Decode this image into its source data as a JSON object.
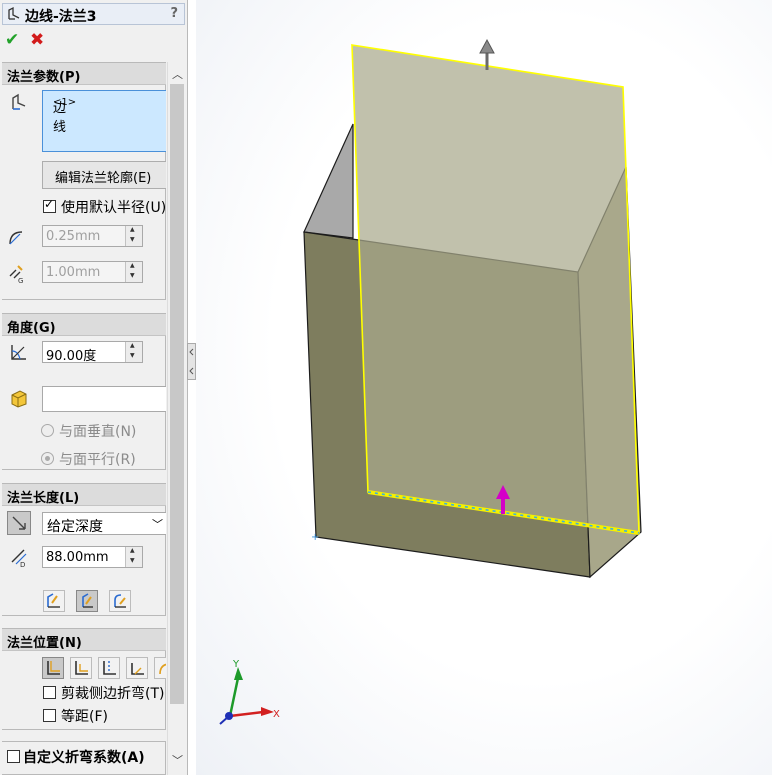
{
  "feature": {
    "title": "边线-法兰3",
    "help": "?",
    "ok_icon": "✔",
    "cancel_icon": "✖"
  },
  "flange_params": {
    "header": "法兰参数(P)",
    "edge_item": "边线",
    "edge_suffix": "<1>",
    "edit_profile_button": "编辑法兰轮廓(E)",
    "use_default_radius": "使用默认半径(U)",
    "use_default_radius_checked": true,
    "radius_value": "0.25mm",
    "gap_value": "1.00mm"
  },
  "angle": {
    "header": "角度(G)",
    "angle_value": "90.00度",
    "face_select_value": "",
    "perpendicular_label": "与面垂直(N)",
    "parallel_label": "与面平行(R)"
  },
  "length": {
    "header": "法兰长度(L)",
    "end_condition": "给定深度",
    "length_value": "88.00mm"
  },
  "position": {
    "header": "法兰位置(N)",
    "trim_side_bends": "剪裁侧边折弯(T)",
    "offset": "等距(F)"
  },
  "custom_bend": {
    "label": "自定义折弯系数(A)"
  },
  "triad": {
    "x": "X",
    "y": "Y"
  },
  "colors": {
    "preview_face": "#a9a98c",
    "model_front": "#7e7d5e",
    "model_side": "#a8a78a",
    "highlight_edge": "#ffff00",
    "drag_arrow": "#d400c8"
  }
}
